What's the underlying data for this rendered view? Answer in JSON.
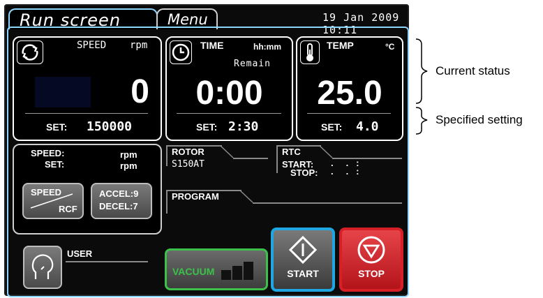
{
  "tabs": {
    "run": "Run screen",
    "menu": "Menu"
  },
  "datetime": "19 Jan 2009 10:11",
  "speed_panel": {
    "label": "SPEED",
    "unit": "rpm",
    "value": "0",
    "set_label": "SET:",
    "set_value": "150000"
  },
  "time_panel": {
    "label": "TIME",
    "unit": "hh:mm",
    "sub": "Remain",
    "value": "0:00",
    "set_label": "SET:",
    "set_value": "2:30"
  },
  "temp_panel": {
    "label": "TEMP",
    "unit": "°C",
    "value": "25.0",
    "set_label": "SET:",
    "set_value": "4.0"
  },
  "lower_left": {
    "speed_label": "SPEED:",
    "speed_unit": "rpm",
    "set_label": "SET:",
    "set_unit": "rpm"
  },
  "buttons": {
    "speed_rcf_top": "SPEED",
    "speed_rcf_bottom": "RCF",
    "accel": "ACCEL:9",
    "decel": "DECEL:7",
    "vacuum": "VACUUM",
    "start": "START",
    "stop": "STOP"
  },
  "rotor": {
    "label": "ROTOR",
    "value": "S150AT"
  },
  "rtc": {
    "label": "RTC",
    "start_label": "START:",
    "start_value": ".     .   :",
    "stop_label": "STOP:",
    "stop_value": ".     .   :"
  },
  "program": {
    "label": "PROGRAM"
  },
  "user": {
    "label": "USER"
  },
  "annotations": {
    "current": "Current status",
    "specified": "Specified setting"
  },
  "colors": {
    "frame": "#8fd6ff",
    "vacuum": "#3cc24a",
    "start": "#1ea7e1",
    "stop": "#d61f26"
  }
}
